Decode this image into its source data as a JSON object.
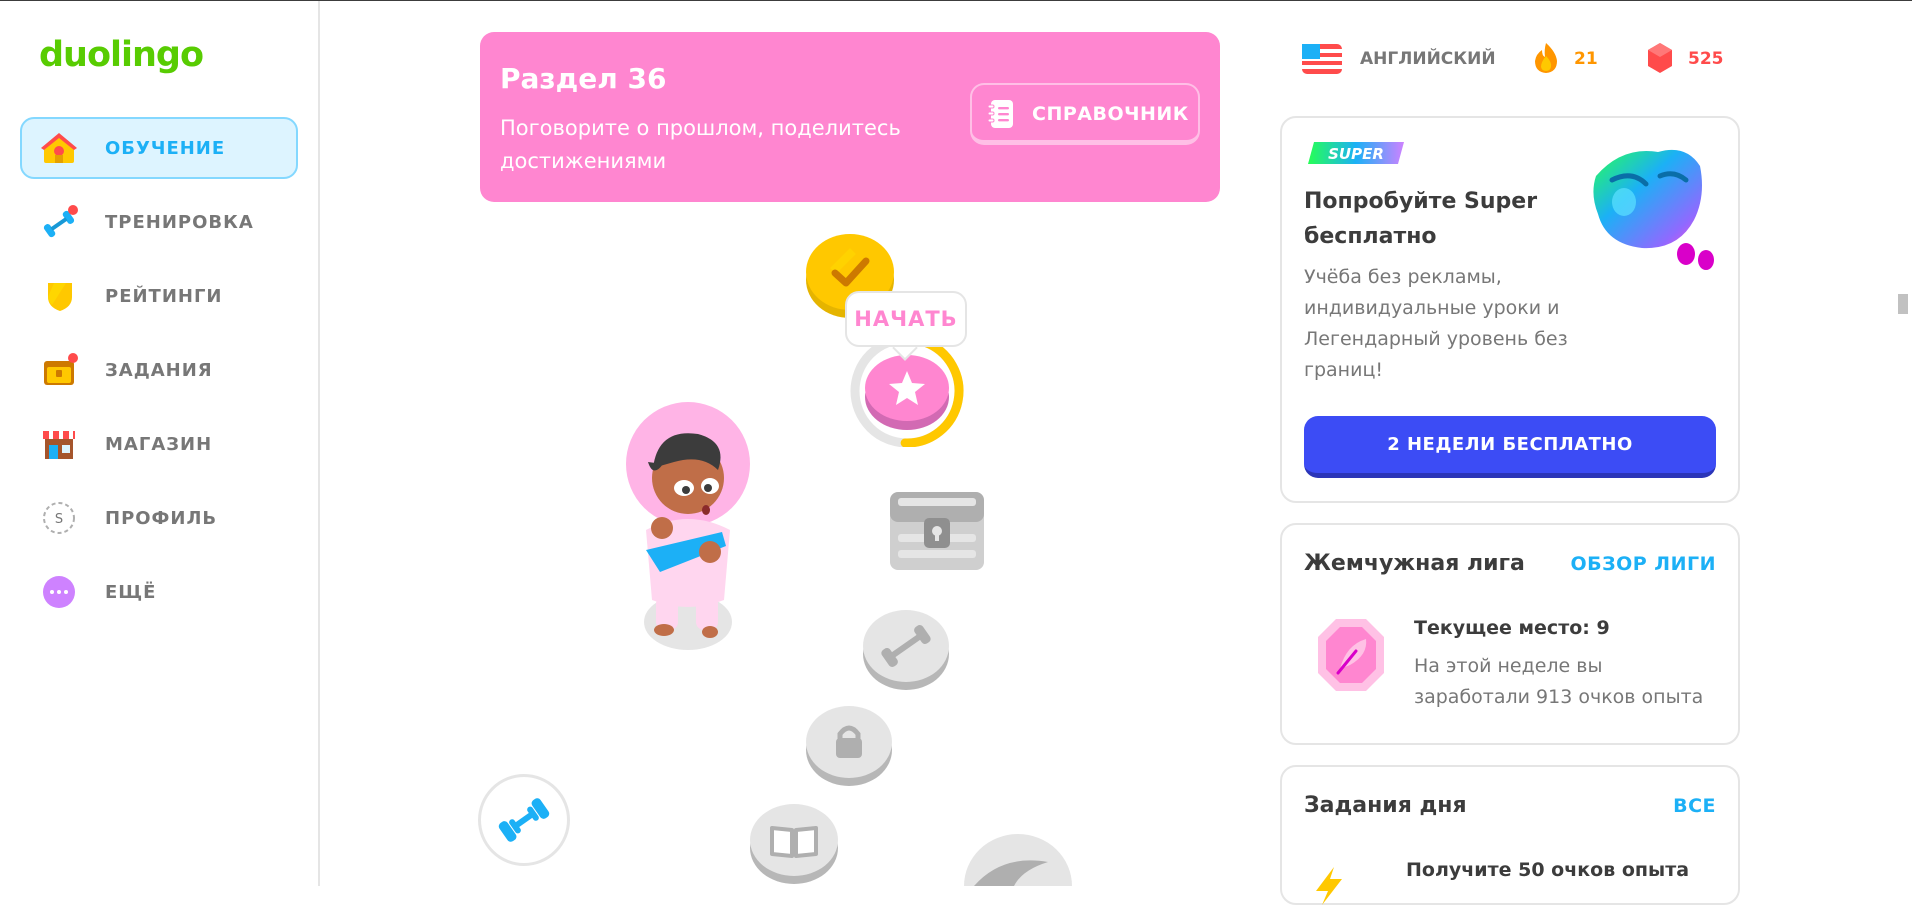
{
  "app": {
    "logo": "duolingo"
  },
  "sidebar": {
    "items": [
      {
        "label": "ОБУЧЕНИЕ",
        "icon": "home-icon",
        "active": true
      },
      {
        "label": "ТРЕНИРОВКА",
        "icon": "dumbbell-icon",
        "badge": true
      },
      {
        "label": "РЕЙТИНГИ",
        "icon": "shield-icon"
      },
      {
        "label": "ЗАДАНИЯ",
        "icon": "chest-icon",
        "badge": true
      },
      {
        "label": "МАГАЗИН",
        "icon": "shop-icon"
      },
      {
        "label": "ПРОФИЛЬ",
        "icon": "profile-icon",
        "avatar_letter": "S"
      },
      {
        "label": "ЕЩЁ",
        "icon": "more-icon"
      }
    ]
  },
  "unit": {
    "title": "Раздел 36",
    "description": "Поговорите о прошлом, поделитесь достижениями",
    "guide_label": "СПРАВОЧНИК"
  },
  "path": {
    "start_label": "НАЧАТЬ",
    "start_progress": 0.45
  },
  "stats": {
    "language": "АНГЛИЙСКИЙ",
    "streak": "21",
    "gems": "525"
  },
  "super_card": {
    "badge": "SUPER",
    "title": "Попробуйте Super бесплатно",
    "text": "Учёба без рекламы, индивидуальные уроки и Легендарный уровень без границ!",
    "button": "2 НЕДЕЛИ БЕСПЛАТНО"
  },
  "league_card": {
    "title": "Жемчужная лига",
    "link": "ОБЗОР ЛИГИ",
    "place": "Текущее место: 9",
    "text": "На этой неделе вы заработали 913 очков опыта"
  },
  "quests_card": {
    "title": "Задания дня",
    "link": "ВСЕ",
    "first_quest": "Получите 50 очков опыта"
  },
  "colors": {
    "brand_green": "#58cc02",
    "accent_blue": "#1cb0f6",
    "unit_pink": "#ff86d0",
    "super_blue": "#3c4cf5",
    "streak_orange": "#ff9600",
    "gem_red": "#ff4b4b"
  }
}
